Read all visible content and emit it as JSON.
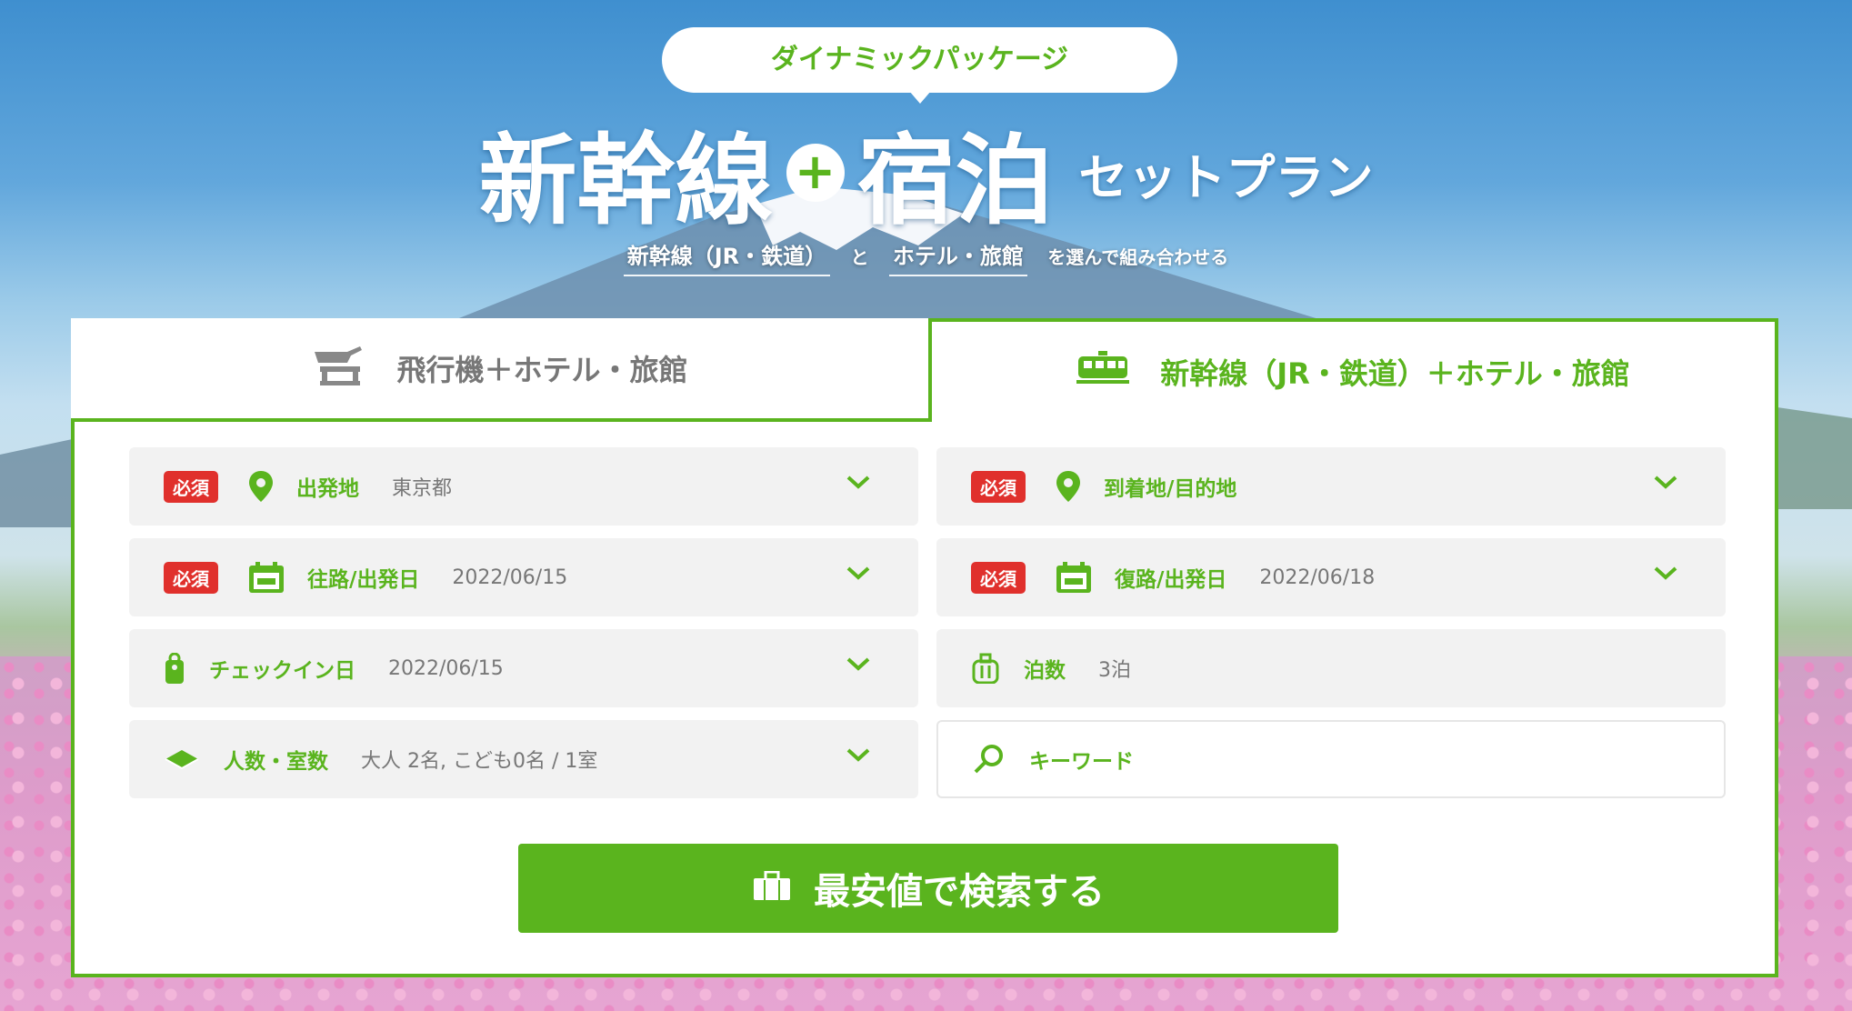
{
  "banner": {
    "badge": "ダイナミックパッケージ",
    "title_part1": "新幹線",
    "title_plus": "+",
    "title_part2": "宿泊",
    "title_suffix": "セットプラン",
    "subtitle_rail": "新幹線（JR・鉄道）",
    "subtitle_and": "と",
    "subtitle_hotel": "ホテル・旅館",
    "subtitle_rest": "を選んで組み合わせる"
  },
  "tabs": [
    {
      "label": "飛行機＋ホテル・旅館",
      "icon": "airplane-icon",
      "active": false
    },
    {
      "label": "新幹線（JR・鉄道）＋ホテル・旅館",
      "icon": "train-icon",
      "active": true
    }
  ],
  "form": {
    "required_badge": "必須",
    "departure": {
      "label": "出発地",
      "value": "東京都",
      "icon": "location-pin-icon"
    },
    "destination": {
      "label": "到着地/目的地",
      "value": "",
      "icon": "location-pin-icon"
    },
    "outbound": {
      "label": "往路/出発日",
      "value": "2022/06/15",
      "icon": "calendar-icon"
    },
    "return": {
      "label": "復路/出発日",
      "value": "2022/06/18",
      "icon": "calendar-icon"
    },
    "checkin": {
      "label": "チェックイン日",
      "value": "2022/06/15",
      "icon": "key-tag-icon"
    },
    "nights": {
      "label": "泊数",
      "value": "3泊",
      "icon": "luggage-icon"
    },
    "guests": {
      "label": "人数・室数",
      "value": "大人 2名, こども0名 / 1室",
      "icon": "room-icon"
    },
    "keyword": {
      "label": "キーワード",
      "value": "",
      "icon": "search-icon"
    }
  },
  "search_button": {
    "label": "最安値で検索する",
    "icon": "bag-icon"
  },
  "colors": {
    "accent": "#5ab41e",
    "required": "#e0302c",
    "field_bg": "#f2f2f2"
  }
}
